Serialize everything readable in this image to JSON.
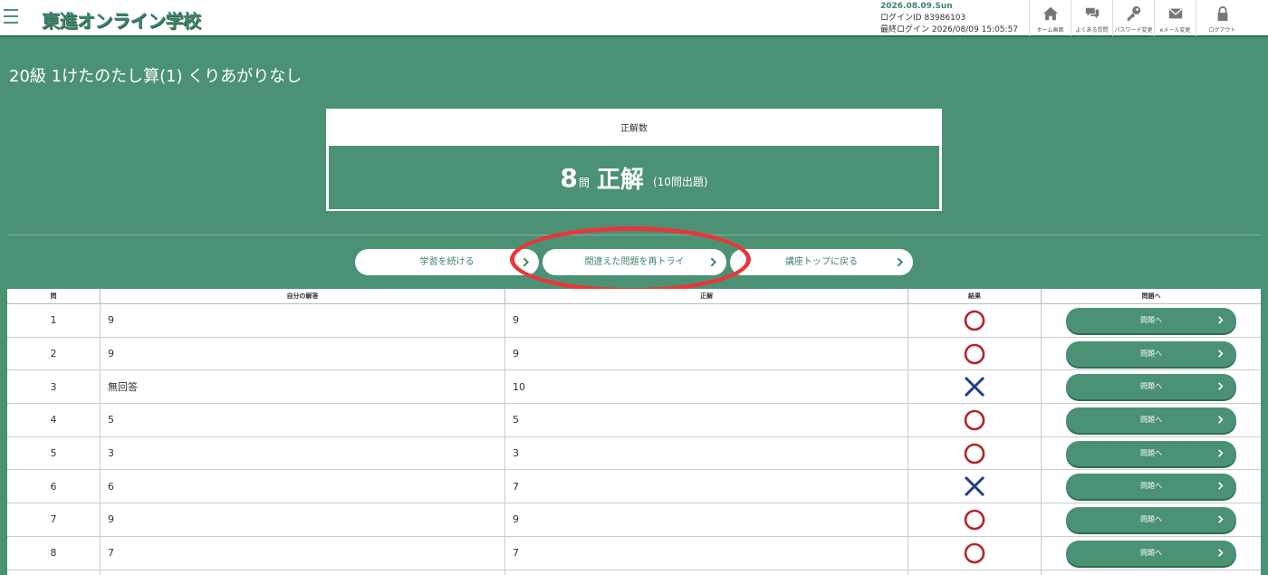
{
  "header": {
    "logo": "東進オンライン学校",
    "date": "2026.08.09.Sun",
    "login_id": "ログインID 83986103",
    "last_login": "最終ログイン 2026/08/09 15:05:57",
    "nav": [
      {
        "label": "ホーム画面",
        "icon": "home-icon"
      },
      {
        "label": "よくある質問",
        "icon": "chat-icon"
      },
      {
        "label": "パスワード変更",
        "icon": "key-icon"
      },
      {
        "label": "eメール変更",
        "icon": "mail-icon"
      },
      {
        "label": "ログアウト",
        "icon": "lock-icon"
      }
    ]
  },
  "page_title": "20級 1けたのたし算(1) くりあがりなし",
  "score": {
    "label": "正解数",
    "correct": "8",
    "unit": "問",
    "text": "正解",
    "total": "(10問出題)"
  },
  "actions": {
    "continue": "学習を続ける",
    "retry": "間違えた問題を再トライ",
    "top": "講座トップに戻る"
  },
  "table": {
    "headers": [
      "問",
      "自分の解答",
      "正解",
      "結果",
      "問題へ"
    ],
    "button_label": "問題へ",
    "rows": [
      {
        "no": "1",
        "answer": "9",
        "correct": "9",
        "result": "correct"
      },
      {
        "no": "2",
        "answer": "9",
        "correct": "9",
        "result": "correct"
      },
      {
        "no": "3",
        "answer": "無回答",
        "correct": "10",
        "result": "wrong"
      },
      {
        "no": "4",
        "answer": "5",
        "correct": "5",
        "result": "correct"
      },
      {
        "no": "5",
        "answer": "3",
        "correct": "3",
        "result": "correct"
      },
      {
        "no": "6",
        "answer": "6",
        "correct": "7",
        "result": "wrong"
      },
      {
        "no": "7",
        "answer": "9",
        "correct": "9",
        "result": "correct"
      },
      {
        "no": "8",
        "answer": "7",
        "correct": "7",
        "result": "correct"
      }
    ]
  },
  "colors": {
    "brand_green": "#4b9274",
    "correct_red": "#b2252c",
    "wrong_navy": "#1f3d8a",
    "highlight_red": "#e8363a"
  }
}
